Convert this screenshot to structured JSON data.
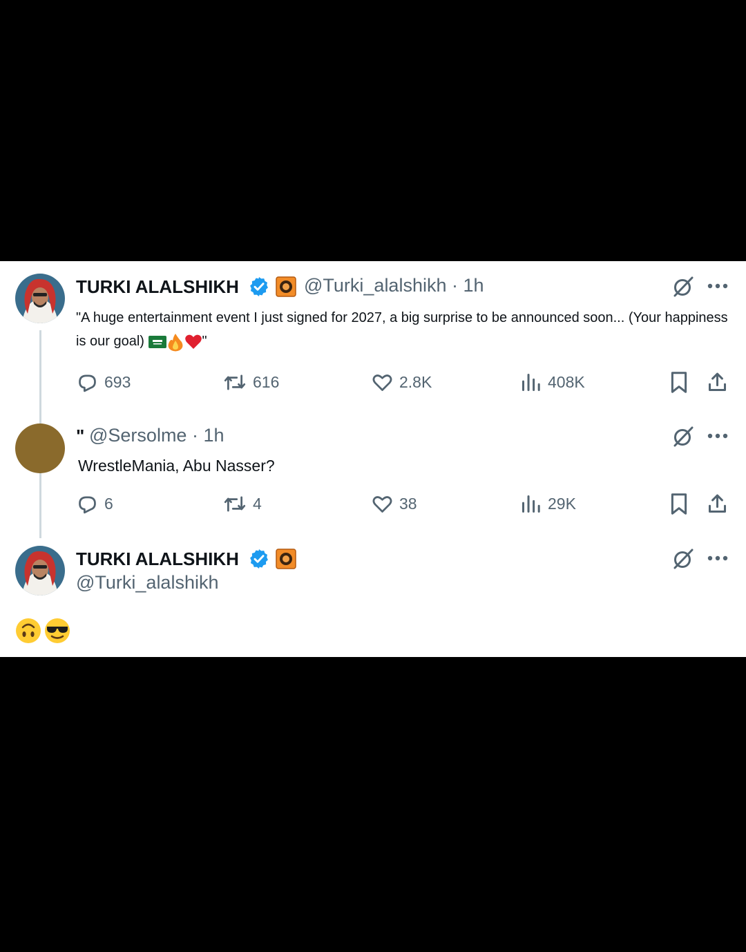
{
  "tweets": [
    {
      "display_name": "TURKI ALALSHIKH",
      "handle_time": "@Turki_alalshikh · 1h",
      "text": "\"A huge entertainment event I just signed for 2027, a big surprise to be announced soon... (Your happiness",
      "text_line2": "is our goal)",
      "text_end": "\"",
      "stats": {
        "replies": "693",
        "reposts": "616",
        "likes": "2.8K",
        "views": "408K"
      }
    },
    {
      "display_name": "\"",
      "handle_time": "@Sersolme · 1h",
      "text": "WrestleMania, Abu Nasser?",
      "stats": {
        "replies": "6",
        "reposts": "4",
        "likes": "38",
        "views": "29K"
      }
    },
    {
      "display_name": "TURKI ALALSHIKH",
      "handle": "@Turki_alalshikh",
      "emoji_reply": "🙃😎"
    }
  ],
  "colors": {
    "verified": "#1d9bf0",
    "badge": "#f28c28",
    "icon_gray": "#536471",
    "thread_line": "#cfd9de",
    "avatar2": "#8a6a2c"
  }
}
